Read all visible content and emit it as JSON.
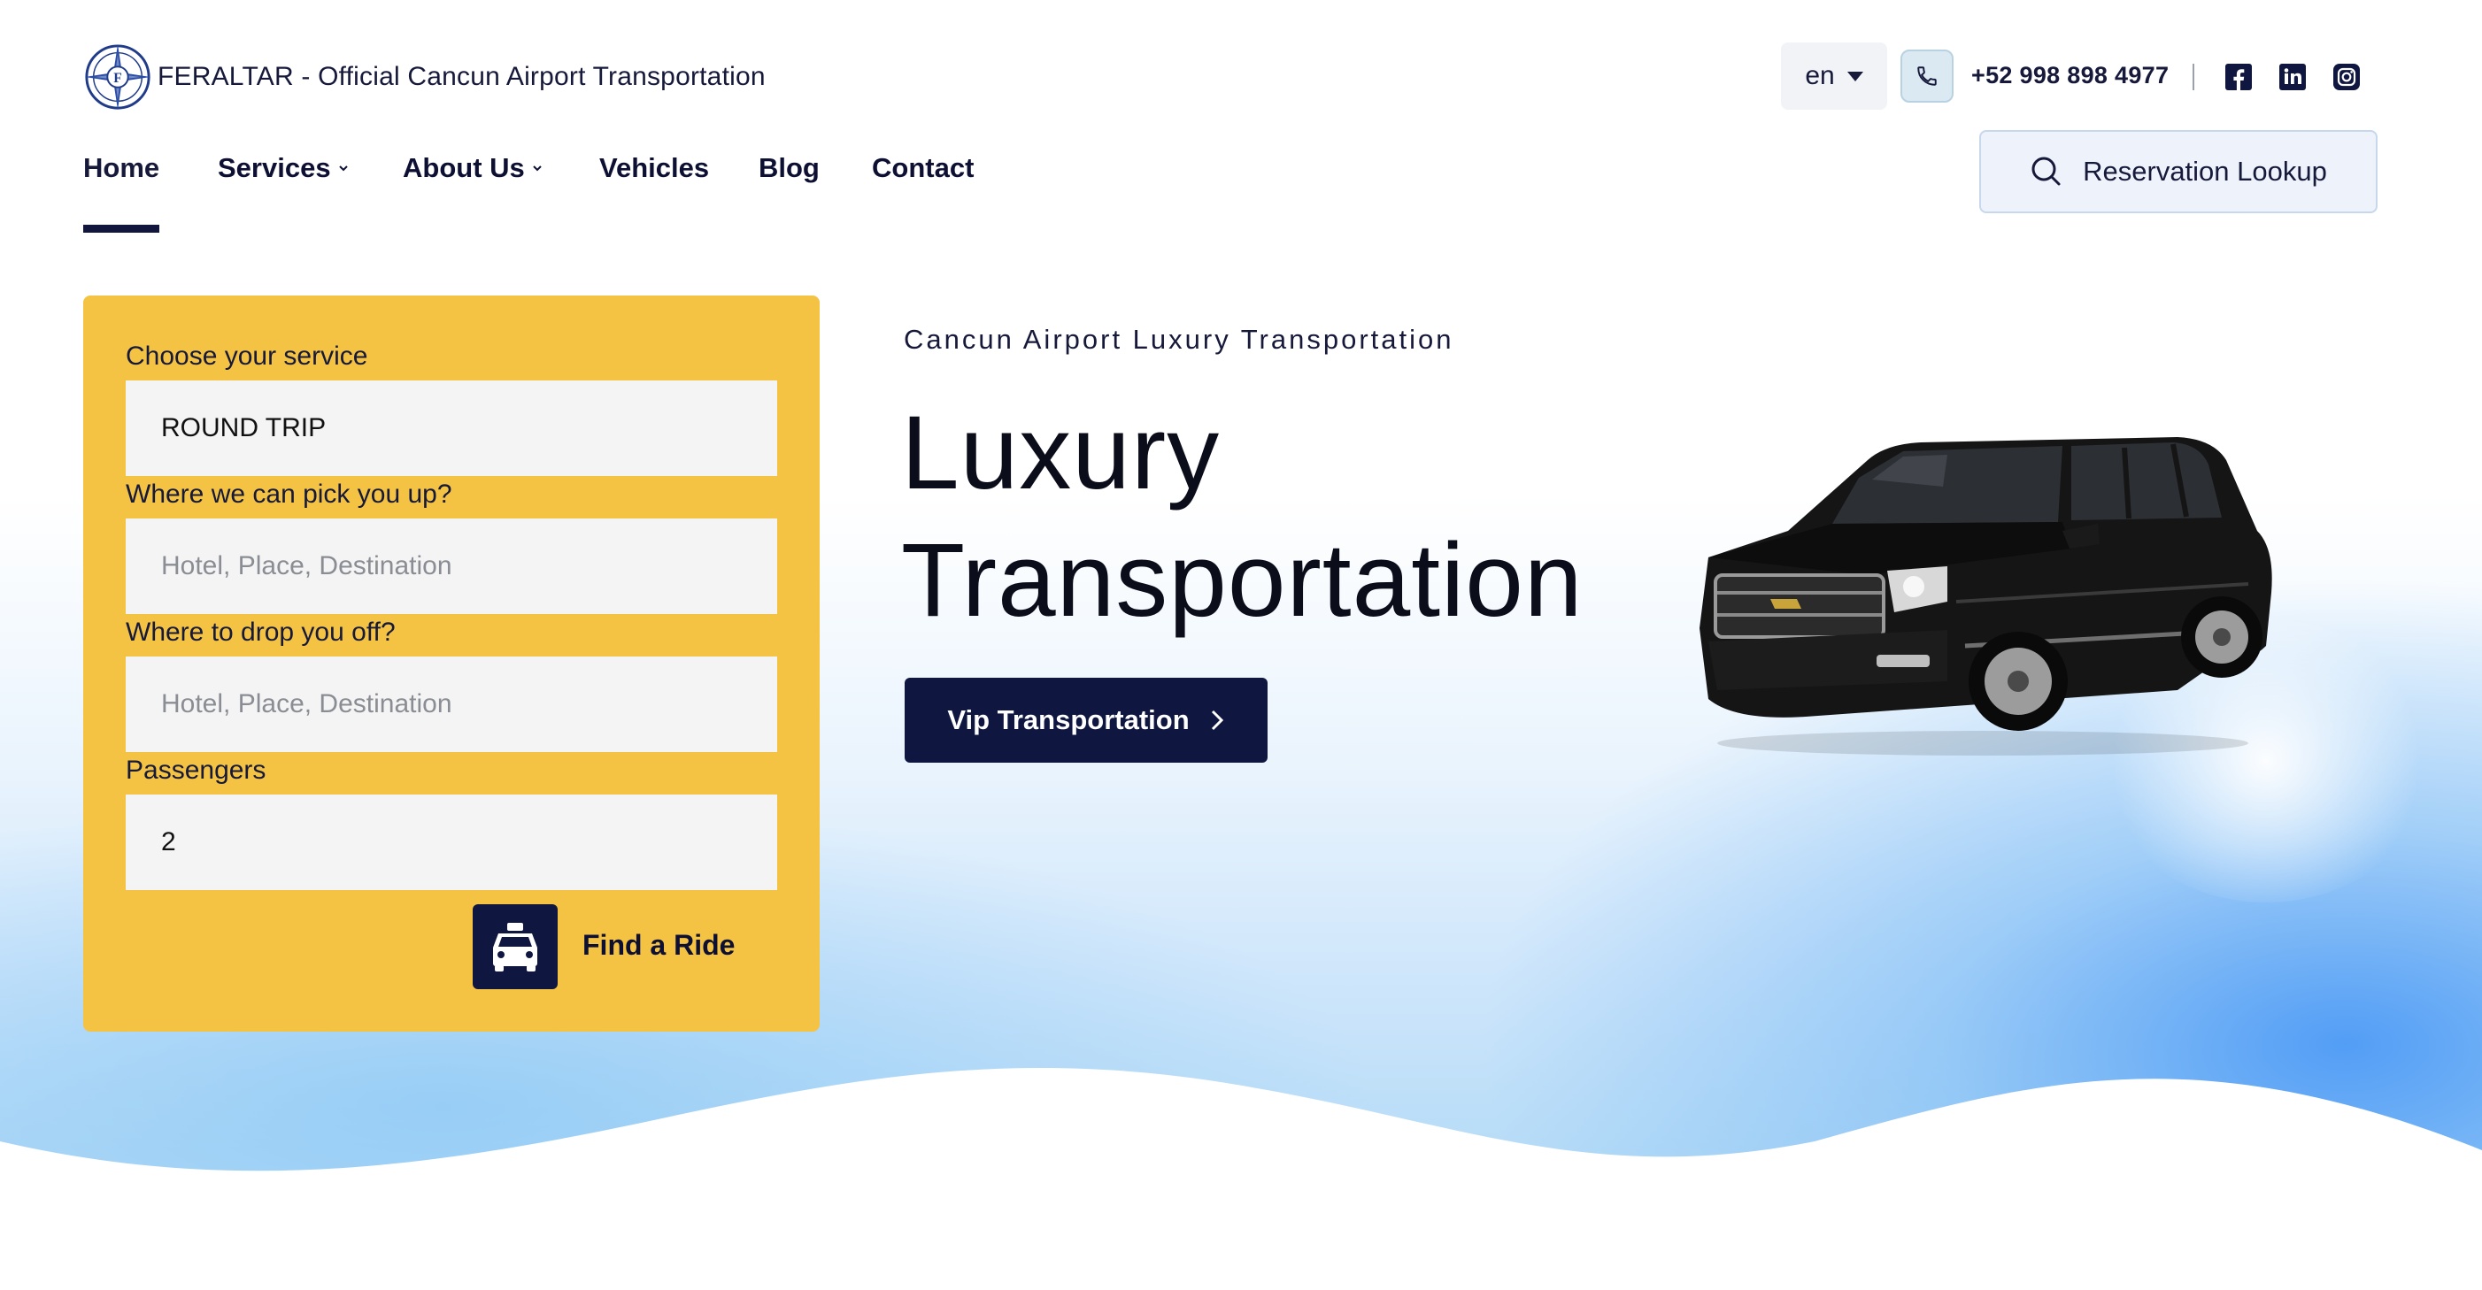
{
  "brand": {
    "name": "FERALTAR - Official Cancun Airport Transportation"
  },
  "topbar": {
    "language": "en",
    "phone": "+52 998 898 4977",
    "social_icons": [
      "facebook-icon",
      "linkedin-icon",
      "instagram-icon"
    ]
  },
  "nav": {
    "items": [
      {
        "label": "Home",
        "active": true
      },
      {
        "label": "Services",
        "dropdown": true
      },
      {
        "label": "About Us",
        "dropdown": true
      },
      {
        "label": "Vehicles"
      },
      {
        "label": "Blog"
      },
      {
        "label": "Contact"
      }
    ],
    "reservation_lookup": "Reservation Lookup"
  },
  "booking": {
    "service_label": "Choose your service",
    "service_value": "ROUND TRIP",
    "pickup_label": "Where we can pick you up?",
    "pickup_placeholder": "Hotel, Place, Destination",
    "dropoff_label": "Where to drop you off?",
    "dropoff_placeholder": "Hotel, Place, Destination",
    "passengers_label": "Passengers",
    "passengers_value": "2",
    "submit_label": "Find a Ride"
  },
  "hero": {
    "eyebrow": "Cancun Airport Luxury Transportation",
    "headline_line1": "Luxury",
    "headline_line2": "Transportation",
    "cta": "Vip Transportation"
  },
  "colors": {
    "navy": "#0f1640",
    "yellow": "#f5c343",
    "field_bg": "#f4f4f4"
  }
}
